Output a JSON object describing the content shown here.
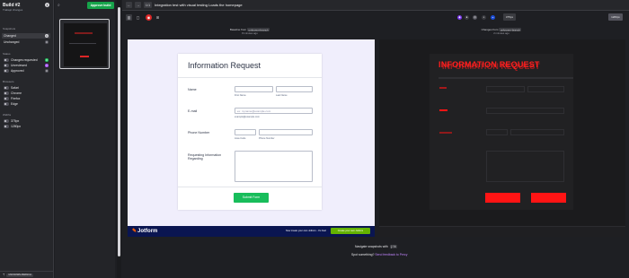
{
  "sidebar": {
    "build_title": "Build #2",
    "build_subtitle": "Trabajó changes",
    "groups_label": "Snapshots",
    "changed_label": "Changed",
    "changed_count": "1",
    "unchanged_label": "Unchanged",
    "unchanged_count": "0",
    "status_label": "Status",
    "status_items": [
      {
        "label": "Changes requested",
        "count": "0",
        "color": "#22c55e"
      },
      {
        "label": "Unreviewed",
        "count": "1",
        "color": "#a855f7"
      },
      {
        "label": "Approved",
        "count": "0",
        "color": "#52525b"
      }
    ],
    "browsers_label": "Browsers",
    "browsers": [
      "Safari",
      "Chrome",
      "Firefox",
      "Edge"
    ],
    "widths_label": "Widths",
    "widths": [
      "375px",
      "1280px"
    ],
    "branch": "UNKNOWN-BRANCH"
  },
  "story": {
    "approve_label": "Approve build"
  },
  "topbar": {
    "back_icon": "←",
    "forward_icon": "→",
    "counter": "1/1",
    "title": "Integration test with visual testing Loads the homepage"
  },
  "toolbar": {
    "viewports": [
      "375px",
      "1280px"
    ]
  },
  "captions": {
    "base_prefix": "Baseline from",
    "base_branch": "unknown-branch",
    "base_time": "8 minutes ago",
    "changed_prefix": "Changes from",
    "changed_branch": "unknown-branch",
    "changed_time": "2 minutes ago"
  },
  "form": {
    "title": "Information Request",
    "name_label": "Name",
    "first_name": "First Name",
    "last_name": "Last Name",
    "email_label": "E-mail",
    "email_placeholder": "ex: myname@example.com",
    "email_sub": "example@example.com",
    "phone_label": "Phone Number",
    "area_code": "Area Code",
    "phone_number": "Phone Number",
    "request_label": "Requesting Information Regarding",
    "submit_label": "Submit Form"
  },
  "jotform": {
    "logo": "Jotform",
    "promo": "Now create your own Jotform - It's free!",
    "cta": "Create your own Jotform"
  },
  "diff": {
    "title": "INFORMATION REQUEST"
  },
  "footer": {
    "navigate_text": "Navigate snapshots with",
    "navigate_key": "j / k",
    "spot_text": "Spot something?",
    "feedback_link": "Send feedback to Percy"
  }
}
